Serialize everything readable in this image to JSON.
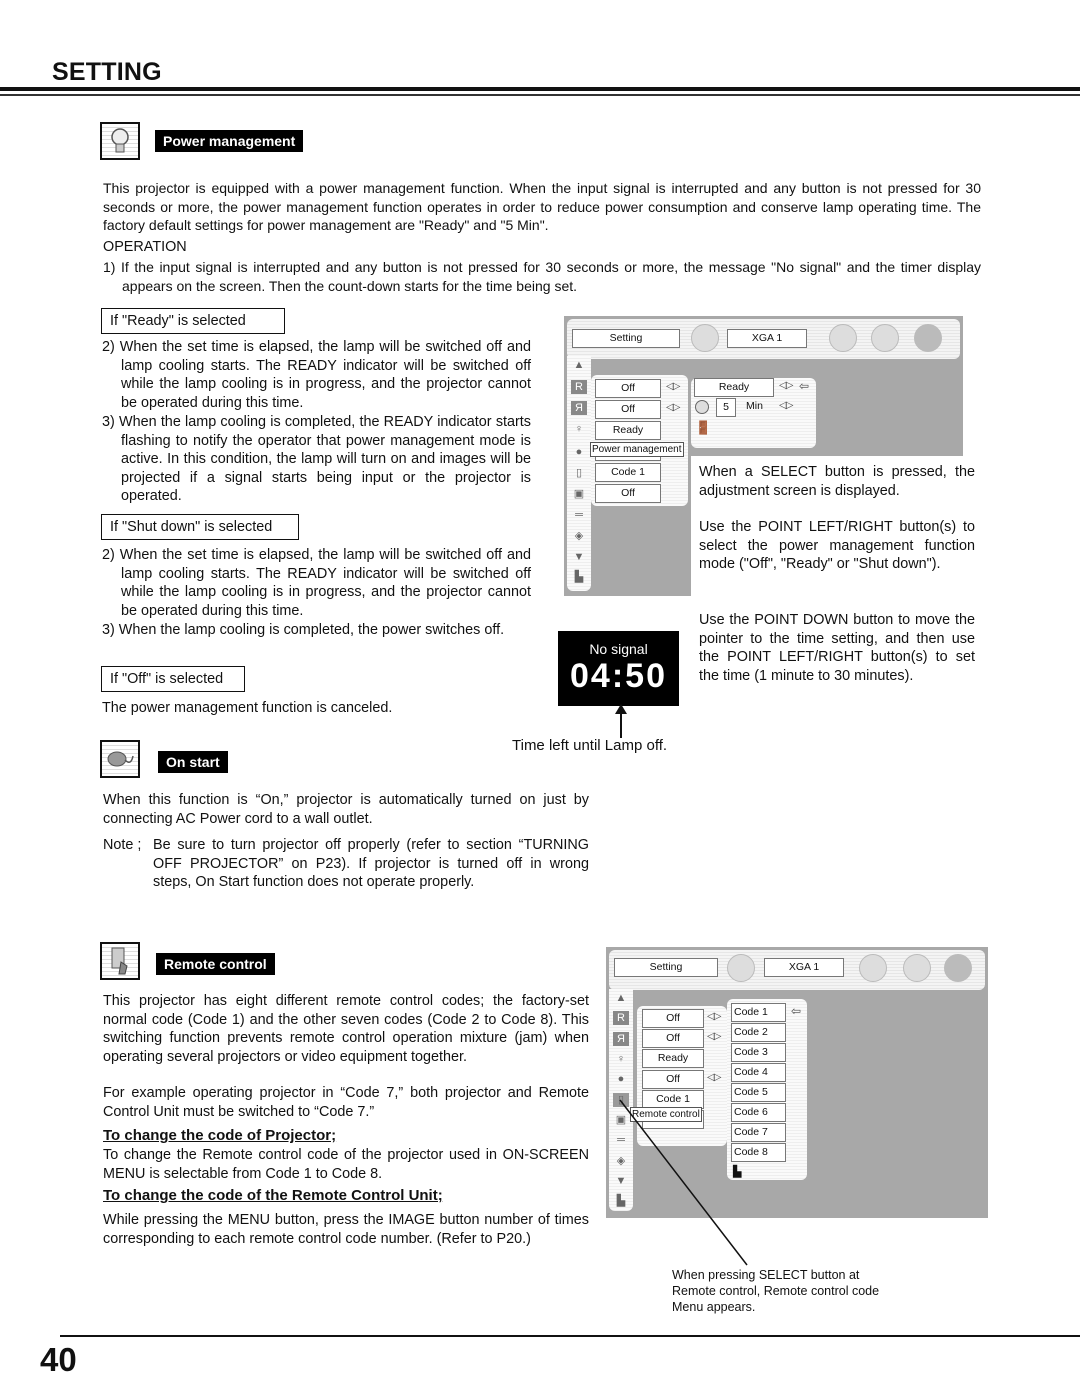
{
  "page": {
    "title": "SETTING",
    "page_number": "40"
  },
  "power_management": {
    "label": "Power management",
    "icon": "lightbulb-icon",
    "intro": "This projector is equipped with a power management function. When the input signal is interrupted and any button is not pressed for 30 seconds or more, the power management function operates in order to reduce power consumption and conserve lamp operating time. The factory default settings for power management are \"Ready\" and \"5 Min\".",
    "operation_heading": "OPERATION",
    "step1": "1) If the input signal is interrupted and any button is not pressed for 30 seconds or more, the message \"No signal\" and the timer display appears on the screen. Then the count-down starts for the time being set.",
    "ready": {
      "label": "If \"Ready\" is selected",
      "step2": "2) When the set time is elapsed, the lamp will be switched off and lamp cooling starts. The READY indicator will be switched off while the lamp cooling is in progress, and the projector cannot be operated during this time.",
      "step3": "3) When the lamp cooling is completed, the READY indicator starts flashing to notify the operator that power management mode is active. In this condition, the lamp will turn on and images will be projected if a signal starts being input or the projector is operated."
    },
    "shutdown": {
      "label": "If \"Shut down\" is selected",
      "step2": "2) When the set time is elapsed, the lamp will be switched off and lamp cooling starts. The READY indicator will be switched off while the lamp cooling is in progress, and the projector cannot be operated during this time.",
      "step3": "3) When the lamp cooling is completed, the power switches off."
    },
    "off": {
      "label": "If \"Off\" is selected",
      "text": "The power management function is canceled."
    },
    "right_text": {
      "p1": "When a SELECT button is pressed, the adjustment screen is displayed.",
      "p2": "Use the POINT LEFT/RIGHT button(s) to select the power management function mode (\"Off\", \"Ready\" or \"Shut down\").",
      "p3": "Use the POINT DOWN button to move the pointer to the time setting, and then use the POINT LEFT/RIGHT button(s) to set the time (1 minute to 30 minutes)."
    },
    "timer_display": {
      "message": "No signal",
      "time": "04:50",
      "caption": "Time left until Lamp off."
    }
  },
  "osd_menu_1": {
    "tab_label": "Setting",
    "source_label": "XGA 1",
    "left_items": [
      "Off",
      "Off",
      "Ready",
      "",
      "Code 1",
      "Off"
    ],
    "tooltip": "Power management",
    "sub_mode": "Ready",
    "timer_value": "5",
    "timer_unit": "Min"
  },
  "on_start": {
    "label": "On start",
    "icon": "power-cord-icon",
    "text": "When this function is “On,” projector is automatically turned on just by connecting AC Power cord to a wall outlet.",
    "note_prefix": "Note ;",
    "note": "Be sure to turn projector off properly (refer to section “TURNING OFF PROJECTOR” on P23).  If projector is turned off in wrong steps, On Start function does not operate properly."
  },
  "remote_control": {
    "label": "Remote control",
    "icon": "remote-control-icon",
    "p1": "This projector has eight different remote control codes; the factory-set normal code (Code 1) and the other seven codes (Code 2 to Code 8).  This switching function prevents remote control operation mixture (jam) when operating several projectors or video equipment together.",
    "p2": "For example operating projector in “Code 7,”  both projector and Remote Control Unit must be switched to “Code 7.”",
    "sub1_heading": "To change the code of Projector;",
    "sub1_text": "To change the Remote control code of the projector used in ON-SCREEN MENU is selectable from Code 1 to Code 8.",
    "sub2_heading": "To change the code of the Remote Control Unit;",
    "sub2_text": "While pressing the MENU button, press the IMAGE button number of times corresponding to each remote control code number. (Refer to P20.)",
    "caption": "When pressing SELECT button at Remote control, Remote control code Menu appears."
  },
  "osd_menu_2": {
    "tab_label": "Setting",
    "source_label": "XGA 1",
    "left_items": [
      "Off",
      "Off",
      "Ready",
      "Off",
      "Code 1"
    ],
    "tooltip": "Remote control",
    "codes": [
      "Code 1",
      "Code 2",
      "Code 3",
      "Code 4",
      "Code 5",
      "Code 6",
      "Code 7",
      "Code 8"
    ]
  }
}
